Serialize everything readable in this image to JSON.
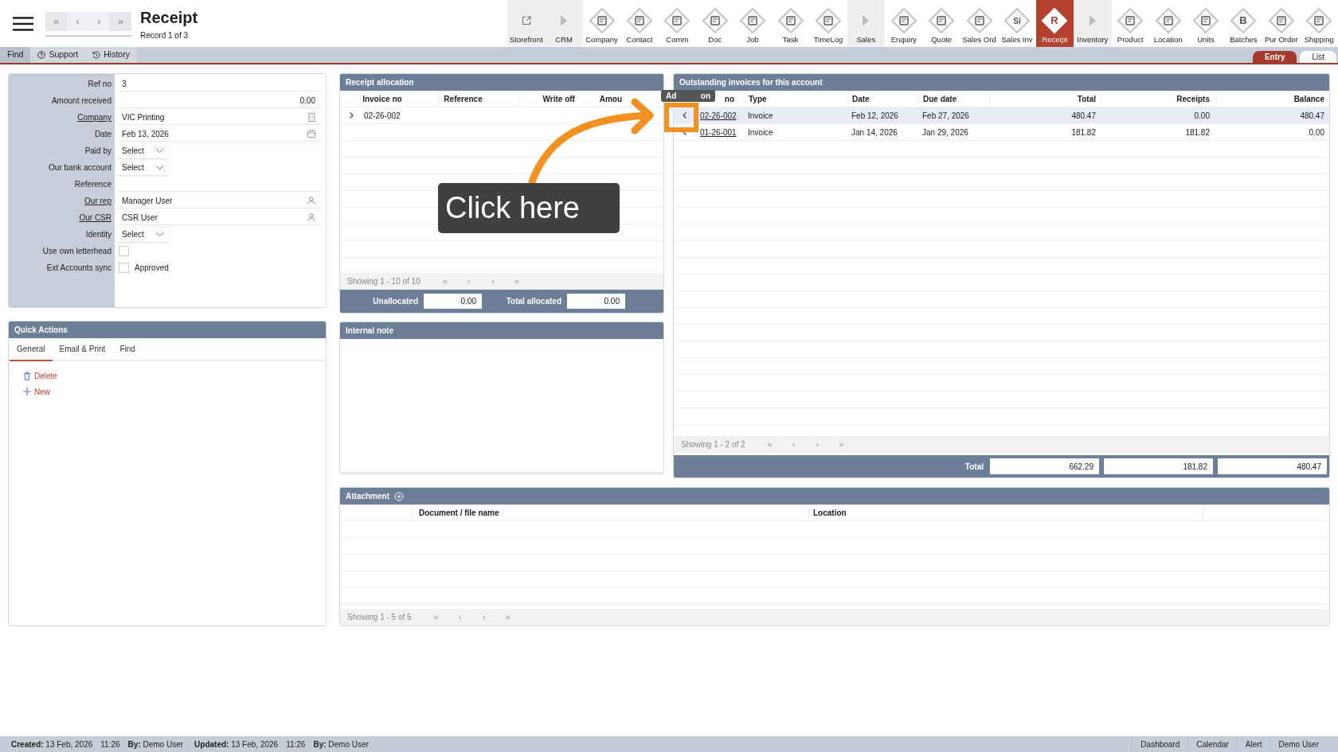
{
  "nav": {
    "buttons": [
      "«",
      "‹",
      "›",
      "»"
    ],
    "title": "Receipt",
    "record": "Record 1 of 3"
  },
  "toolbar": [
    {
      "kind": "link",
      "label": "Storefront",
      "selected": false
    },
    {
      "kind": "group",
      "label": "CRM",
      "selected": false
    },
    {
      "kind": "module",
      "label": "Company",
      "selected": false
    },
    {
      "kind": "module",
      "label": "Contact",
      "selected": false
    },
    {
      "kind": "module",
      "label": "Comm",
      "selected": false
    },
    {
      "kind": "module",
      "label": "Doc",
      "selected": false
    },
    {
      "kind": "module",
      "label": "Job",
      "selected": false
    },
    {
      "kind": "module",
      "label": "Task",
      "selected": false
    },
    {
      "kind": "module",
      "label": "TimeLog",
      "selected": false
    },
    {
      "kind": "group",
      "label": "Sales",
      "selected": false
    },
    {
      "kind": "module",
      "label": "Enquiry",
      "selected": false
    },
    {
      "kind": "module",
      "label": "Quote",
      "selected": false
    },
    {
      "kind": "module",
      "label": "Sales Ord",
      "selected": false
    },
    {
      "kind": "module",
      "label": "Sales Inv",
      "glyph": "Si",
      "selected": false
    },
    {
      "kind": "module",
      "label": "Receipt",
      "glyph": "R",
      "selected": true
    },
    {
      "kind": "group",
      "label": "Inventory",
      "selected": false
    },
    {
      "kind": "module",
      "label": "Product",
      "selected": false
    },
    {
      "kind": "module",
      "label": "Location",
      "selected": false
    },
    {
      "kind": "module",
      "label": "Units",
      "selected": false
    },
    {
      "kind": "module",
      "label": "Batches",
      "glyph": "B",
      "selected": false
    },
    {
      "kind": "module",
      "label": "Pur Order",
      "selected": false
    },
    {
      "kind": "module",
      "label": "Shipping",
      "selected": false
    }
  ],
  "subbar": {
    "actions": [
      {
        "kind": "plain",
        "label": "Find"
      },
      {
        "kind": "help",
        "label": "Support"
      },
      {
        "kind": "history",
        "label": "History"
      }
    ],
    "view_tabs": [
      {
        "label": "Entry",
        "selected": true
      },
      {
        "label": "List",
        "selected": false
      }
    ]
  },
  "form": {
    "fields": [
      {
        "label": "Ref no",
        "link": false,
        "kind": "text",
        "value": "3"
      },
      {
        "label": "Amount received",
        "link": false,
        "kind": "number",
        "value": "0.00"
      },
      {
        "label": "Company",
        "link": true,
        "kind": "lookup",
        "value": "VIC Printing"
      },
      {
        "label": "Date",
        "link": false,
        "kind": "date",
        "value": "Feb 13, 2026"
      },
      {
        "label": "Paid by",
        "link": false,
        "kind": "select",
        "value": "Select"
      },
      {
        "label": "Our bank account",
        "link": false,
        "kind": "select",
        "value": "Select"
      },
      {
        "label": "Reference",
        "link": false,
        "kind": "text"
      },
      {
        "label": "Our rep",
        "link": true,
        "kind": "person",
        "value": "Manager User"
      },
      {
        "label": "Our CSR",
        "link": true,
        "kind": "person",
        "value": "CSR User"
      },
      {
        "label": "Identity",
        "link": false,
        "kind": "select",
        "value": "Select"
      },
      {
        "label": "Use own letterhead",
        "link": false,
        "kind": "checkbox",
        "checked": false
      },
      {
        "label": "Ext Accounts sync",
        "link": false,
        "kind": "checkbox",
        "checked": false,
        "caption": "Approved"
      }
    ]
  },
  "quick_actions": {
    "title": "Quick Actions",
    "tabs": [
      {
        "label": "General",
        "selected": true
      },
      {
        "label": "Email & Print",
        "selected": false
      },
      {
        "label": "Find",
        "selected": false
      }
    ],
    "actions": [
      {
        "kind": "delete",
        "label": "Delete"
      },
      {
        "kind": "new",
        "label": "New"
      }
    ]
  },
  "allocation": {
    "title": "Receipt allocation",
    "columns": [
      "Invoice no",
      "Reference",
      "Write off",
      "Amou"
    ],
    "rows": [
      {
        "cells": [
          "02-26-002"
        ]
      }
    ],
    "pager": {
      "text": "Showing 1 - 10 of 10",
      "buttons": [
        "«",
        "‹",
        "›",
        "»"
      ]
    },
    "totals": [
      {
        "label": "Unallocated",
        "value": "0.00"
      },
      {
        "label": "Total allocated",
        "value": "0.00"
      }
    ]
  },
  "internal_note": {
    "title": "Internal note"
  },
  "outstanding": {
    "title": "Outstanding invoices for this account",
    "columns": [
      "no",
      "Type",
      "Date",
      "Due date",
      "Total",
      "Receipts",
      "Balance"
    ],
    "rows": [
      {
        "selected": true,
        "cells": [
          "02-26-002",
          "Invoice",
          "Feb 12, 2026",
          "Feb 27, 2026",
          "480.47",
          "0.00",
          "480.47"
        ]
      },
      {
        "selected": false,
        "cells": [
          "01-26-001",
          "Invoice",
          "Jan 14, 2026",
          "Jan 29, 2026",
          "181.82",
          "181.82",
          "0.00"
        ]
      }
    ],
    "pager": {
      "text": "Showing 1 - 2 of 2",
      "buttons": [
        "«",
        "‹",
        "›",
        "»"
      ]
    },
    "totals": {
      "label": "Total",
      "values": [
        "662.29",
        "181.82",
        "480.47"
      ]
    }
  },
  "attachment": {
    "title": "Attachment",
    "columns": [
      "Document / file name",
      "Location"
    ],
    "pager": {
      "text": "Showing 1 - 5 of 5",
      "buttons": [
        "«",
        "‹",
        "›",
        "»"
      ]
    }
  },
  "tooltip": {
    "start": "Ad",
    "end": "on"
  },
  "callout": {
    "text": "Click here"
  },
  "status_bar": {
    "items": [
      "**Created:** 13 Feb, 2026",
      "11:26",
      "**By:** Demo User",
      "**Updated:** 13 Feb, 2026",
      "11:26",
      "**By:** Demo User"
    ],
    "links": [
      "Dashboard",
      "Calendar",
      "Alert",
      "Demo User"
    ]
  }
}
